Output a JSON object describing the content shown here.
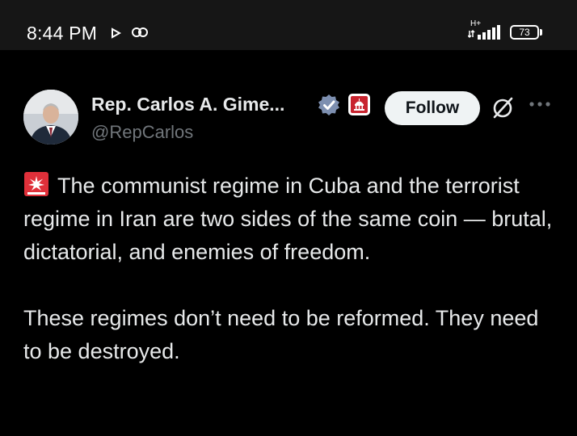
{
  "status_bar": {
    "time": "8:44 PM",
    "network_type": "H+",
    "battery_level": "73",
    "icons": [
      "play-icon",
      "link-icon",
      "signal-icon",
      "battery-icon"
    ]
  },
  "tweet": {
    "author": {
      "display_name": "Rep. Carlos A. Gime...",
      "handle": "@RepCarlos",
      "badges": [
        "verified-badge-icon",
        "government-affiliate-icon"
      ]
    },
    "follow_label": "Follow",
    "paragraphs": [
      "The communist regime in Cuba and the terrorist regime in Iran are two sides of the same coin — brutal, dictatorial, and enemies of freedom.",
      "These regimes don’t need to be reformed. They need to be destroyed."
    ],
    "leading_emoji": "siren-icon"
  },
  "colors": {
    "background": "#000000",
    "status_bar": "#161616",
    "text_primary": "#e7e9ea",
    "text_secondary": "#71767b",
    "verified_blue": "#7d8fb0",
    "siren_red": "#e0303a",
    "follow_button_bg": "#eff3f4"
  }
}
